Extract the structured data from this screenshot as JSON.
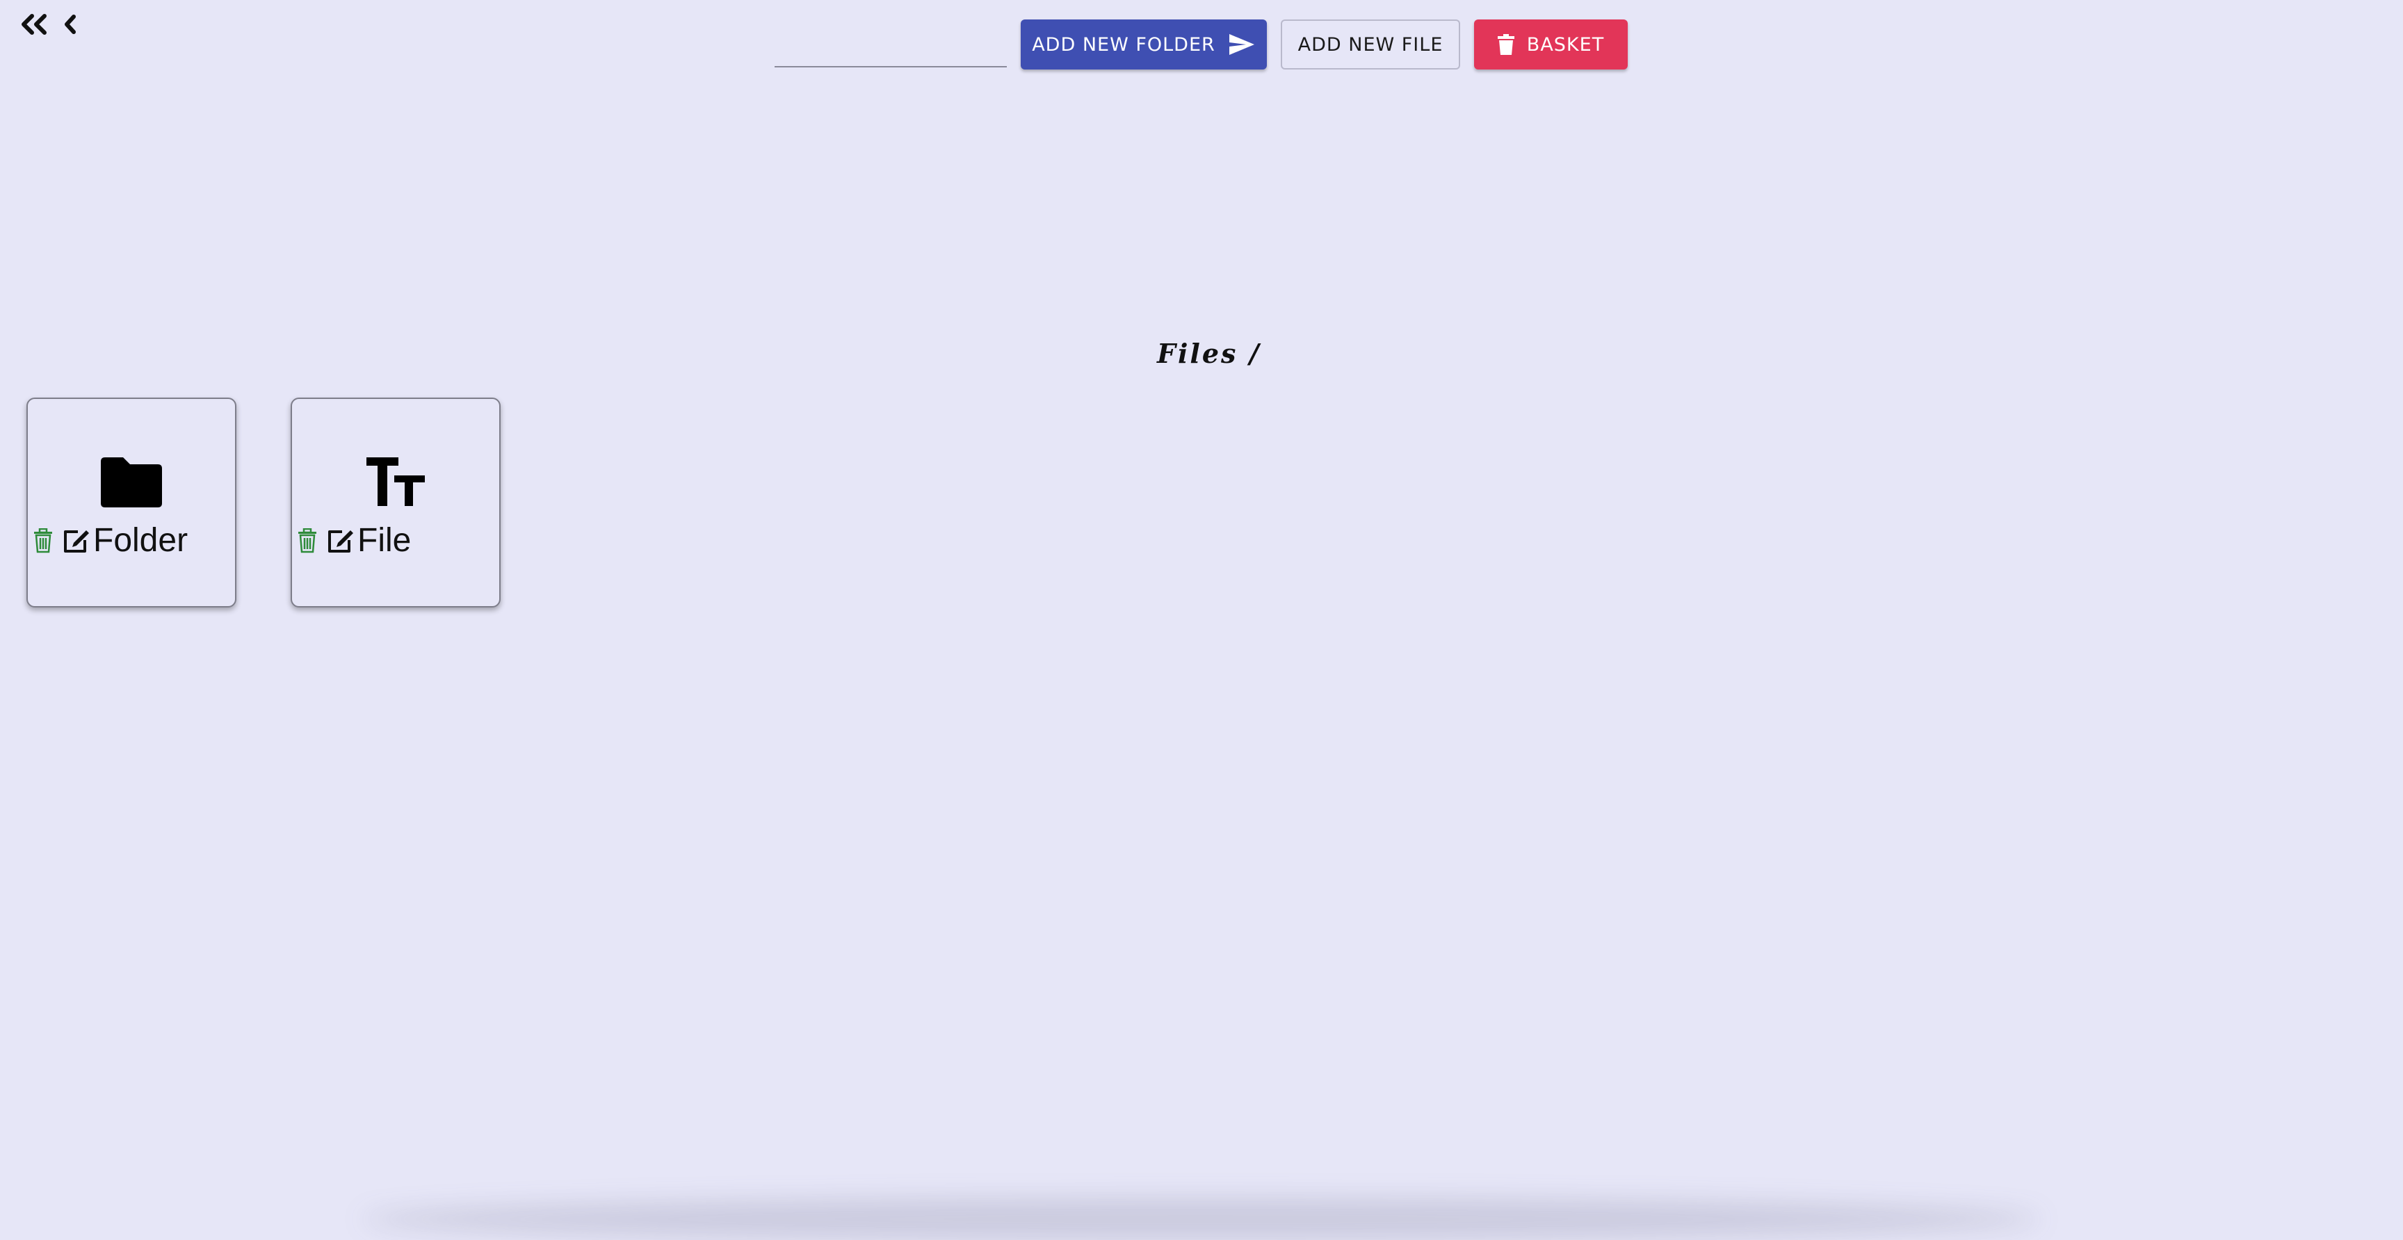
{
  "nav": {
    "first_icon": "double-chevron-left-icon",
    "back_icon": "chevron-left-icon"
  },
  "toolbar": {
    "name_input_value": "",
    "add_folder_label": "ADD NEW FOLDER",
    "add_folder_icon": "send-icon",
    "add_file_label": "ADD NEW FILE",
    "basket_label": "BASKET",
    "basket_icon": "trash-icon"
  },
  "breadcrumb": {
    "path": "Files /"
  },
  "items": [
    {
      "label": "Folder",
      "icon": "folder-icon",
      "delete_icon": "trash-icon",
      "edit_icon": "edit-icon"
    },
    {
      "label": "File",
      "icon": "text-icon",
      "delete_icon": "trash-icon",
      "edit_icon": "edit-icon"
    }
  ],
  "colors": {
    "background": "#e6e6f7",
    "primary": "#3f4fb2",
    "danger": "#e23558",
    "delete_icon": "#2e8b3a"
  }
}
